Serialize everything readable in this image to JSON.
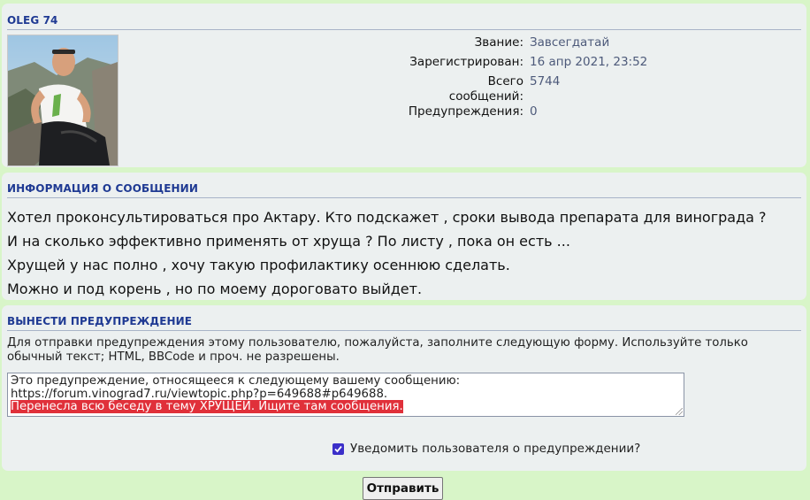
{
  "profile": {
    "username": "OLEG 74",
    "rank_label": "Звание:",
    "rank_value": "Завсегдатай",
    "registered_label": "Зарегистрирован:",
    "registered_value": "16 апр 2021, 23:52",
    "posts_label_1": "Всего",
    "posts_label_2": "сообщений:",
    "posts_value": "5744",
    "warnings_label": "Предупреждения:",
    "warnings_value": "0"
  },
  "message_info": {
    "title": "ИНФОРМАЦИЯ О СООБЩЕНИИ",
    "lines": [
      "Хотел проконсультироваться про Актару. Кто подскажет , сроки вывода препарата для винограда ?",
      "И на сколько эффективно применять от хруща ? По листу , пока он есть ...",
      "Хрущей у нас полно , хочу такую профилактику осеннюю сделать.",
      "Можно и под корень , но по моему дороговато выйдет."
    ]
  },
  "warning_form": {
    "title": "ВЫНЕСТИ ПРЕДУПРЕЖДЕНИЕ",
    "instructions": "Для отправки предупреждения этому пользователю, пожалуйста, заполните следующую форму. Используйте только обычный текст; HTML, BBCode и проч. не разрешены.",
    "text_line_1": "Это предупреждение, относящееся к следующему вашему сообщению:",
    "text_line_2": "https://forum.vinograd7.ru/viewtopic.php?p=649688#p649688.",
    "text_line_3": "Перенесла всю беседу в тему ХРУЩЕЙ. Ищите там сообщения.",
    "notify_label": "Уведомить пользователя о предупреждении?",
    "notify_checked": true,
    "submit_label": "Отправить"
  }
}
